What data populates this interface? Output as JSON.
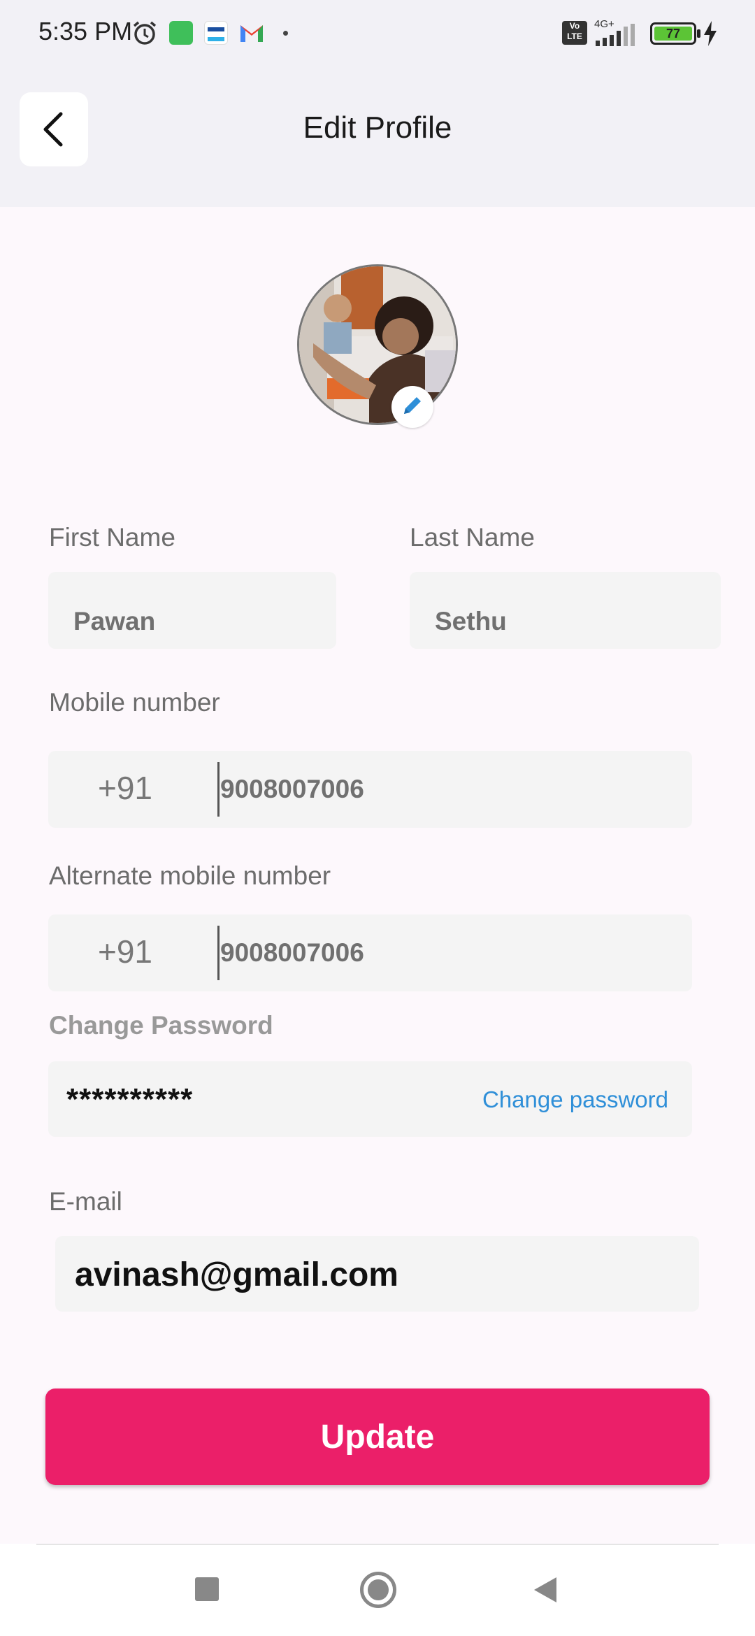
{
  "status_bar": {
    "time": "5:35 PM",
    "battery": "77",
    "network": "4G+",
    "volte": "Vo LTE"
  },
  "header": {
    "title": "Edit Profile",
    "back_icon": "chevron-left-icon"
  },
  "avatar": {
    "edit_icon": "pencil-icon"
  },
  "form": {
    "first_name_label": "First Name",
    "first_name_value": "Pawan",
    "last_name_label": "Last Name",
    "last_name_value": "Sethu",
    "mobile_label": "Mobile number",
    "mobile_country_code": "+91",
    "mobile_value": "9008007006",
    "alt_mobile_label": "Alternate mobile number",
    "alt_mobile_country_code": "+91",
    "alt_mobile_value": "9008007006",
    "password_label": "Change Password",
    "password_value": "**********",
    "change_password_link": "Change password",
    "email_label": "E-mail",
    "email_value": "avinash@gmail.com"
  },
  "update_button": "Update",
  "colors": {
    "accent": "#eb1f69",
    "link": "#2f8fd8"
  }
}
